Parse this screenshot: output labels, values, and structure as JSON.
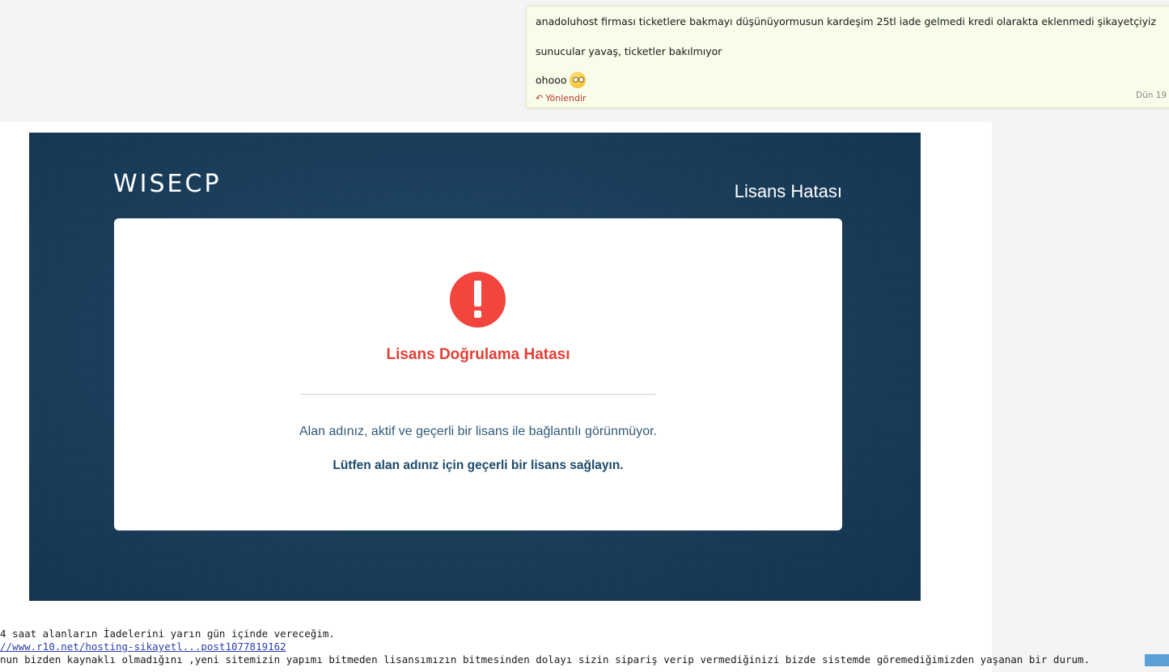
{
  "chat": {
    "line1": "anadoluhost firması ticketlere bakmayı düşünüyormusun kardeşim 25tl iade gelmedi kredi olarakta eklenmedi şikayetçiyiz",
    "line2": "sunucular yavaş, ticketler bakılmıyor",
    "line3": "ohooo",
    "emoji": "flushed-face-emoji",
    "reply_label": "Yönlendir",
    "time": "Dün 19"
  },
  "screenshot": {
    "logo": "WISECP",
    "header": "Lisans Hatası",
    "error_title": "Lisans Doğrulama Hatası",
    "message": "Alan adınız, aktif ve geçerli bir lisans ile bağlantılı görünmüyor.",
    "message_bold": "Lütfen alan adınız için geçerli bir lisans sağlayın."
  },
  "post": {
    "line1": "4 saat alanların İadelerini yarın gün içinde vereceğim.",
    "link": "//www.r10.net/hosting-sikayetl...post1077819162",
    "line3": "nun bizden kaynaklı olmadığını ,yeni sitemizin yapımı bitmeden lisansımızın bitmesinden dolayı sizin sipariş verip vermediğinizi bizde sistemde göremediğimizden yaşanan bir durum."
  },
  "colors": {
    "accent_red": "#f2453d",
    "panel_blue": "#1b3f5c",
    "bubble_green": "#f7fde9"
  }
}
